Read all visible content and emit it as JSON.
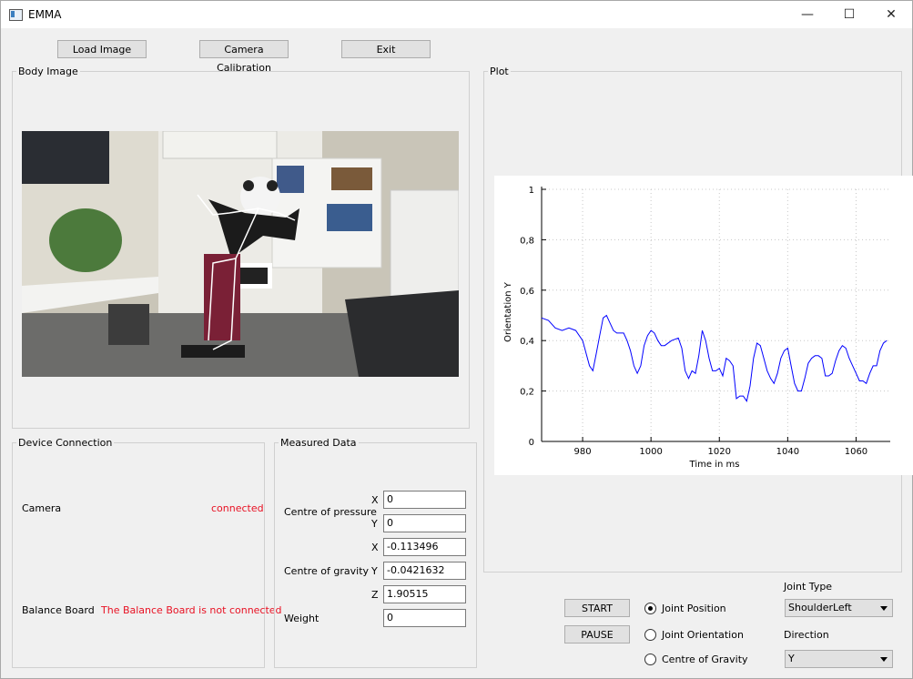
{
  "window": {
    "title": "EMMA",
    "minimize": "—",
    "maximize": "☐",
    "close": "✕"
  },
  "toolbar": {
    "load_image": "Load Image",
    "camera_calibration": "Camera Calibration",
    "exit": "Exit"
  },
  "body_image": {
    "title": "Body Image"
  },
  "plot": {
    "title": "Plot"
  },
  "device_connection": {
    "title": "Device Connection",
    "camera_label": "Camera",
    "camera_status": "connected",
    "board_label": "Balance Board",
    "board_status": "The Balance Board is not connected",
    "status_color": "#e81123"
  },
  "measured_data": {
    "title": "Measured Data",
    "cop_label": "Centre of pressure",
    "cog_label": "Centre of gravity",
    "weight_label": "Weight",
    "x": "X",
    "y": "Y",
    "z": "Z",
    "cop_x": "0",
    "cop_y": "0",
    "cog_x": "-0.113496",
    "cog_y": "-0.0421632",
    "cog_z": "1.90515",
    "weight": "0"
  },
  "controls": {
    "start": "START",
    "pause": "PAUSE",
    "radio_joint_position": "Joint Position",
    "radio_joint_orientation": "Joint Orientation",
    "radio_cog": "Centre of Gravity",
    "selected": "Joint Position",
    "joint_type_label": "Joint Type",
    "joint_type_value": "ShoulderLeft",
    "direction_label": "Direction",
    "direction_value": "Y"
  },
  "chart_data": {
    "type": "line",
    "xlabel": "Time in ms",
    "ylabel": "Orientation Y",
    "xlim": [
      968,
      1070
    ],
    "ylim": [
      0,
      1
    ],
    "xticks": [
      980,
      1000,
      1020,
      1040,
      1060
    ],
    "yticks": [
      0,
      0.2,
      0.4,
      0.6,
      0.8,
      1
    ],
    "ytick_labels": [
      "0",
      "0,2",
      "0,4",
      "0,6",
      "0,8",
      "1"
    ],
    "grid": true,
    "color": "#0000ff",
    "x": [
      968,
      970,
      972,
      974,
      976,
      978,
      980,
      982,
      983,
      984,
      985,
      986,
      987,
      988,
      989,
      990,
      992,
      993,
      994,
      995,
      996,
      997,
      998,
      999,
      1000,
      1001,
      1002,
      1003,
      1004,
      1006,
      1008,
      1009,
      1010,
      1011,
      1012,
      1013,
      1014,
      1015,
      1016,
      1017,
      1018,
      1019,
      1020,
      1021,
      1022,
      1023,
      1024,
      1025,
      1026,
      1027,
      1028,
      1029,
      1030,
      1031,
      1032,
      1033,
      1034,
      1035,
      1036,
      1037,
      1038,
      1039,
      1040,
      1041,
      1042,
      1043,
      1044,
      1045,
      1046,
      1047,
      1048,
      1049,
      1050,
      1051,
      1052,
      1053,
      1054,
      1055,
      1056,
      1057,
      1058,
      1059,
      1060,
      1061,
      1062,
      1063,
      1064,
      1065,
      1066,
      1067,
      1068,
      1069
    ],
    "values": [
      0.49,
      0.48,
      0.45,
      0.44,
      0.45,
      0.44,
      0.4,
      0.3,
      0.28,
      0.35,
      0.42,
      0.49,
      0.5,
      0.47,
      0.44,
      0.43,
      0.43,
      0.4,
      0.36,
      0.3,
      0.27,
      0.3,
      0.38,
      0.42,
      0.44,
      0.43,
      0.4,
      0.38,
      0.38,
      0.4,
      0.41,
      0.37,
      0.28,
      0.25,
      0.28,
      0.27,
      0.34,
      0.44,
      0.4,
      0.33,
      0.28,
      0.28,
      0.29,
      0.26,
      0.33,
      0.32,
      0.3,
      0.17,
      0.18,
      0.18,
      0.16,
      0.22,
      0.33,
      0.39,
      0.38,
      0.33,
      0.28,
      0.25,
      0.23,
      0.27,
      0.33,
      0.36,
      0.37,
      0.3,
      0.23,
      0.2,
      0.2,
      0.25,
      0.31,
      0.33,
      0.34,
      0.34,
      0.33,
      0.26,
      0.26,
      0.27,
      0.32,
      0.36,
      0.38,
      0.37,
      0.33,
      0.3,
      0.27,
      0.24,
      0.24,
      0.23,
      0.27,
      0.3,
      0.3,
      0.36,
      0.39,
      0.4
    ]
  }
}
